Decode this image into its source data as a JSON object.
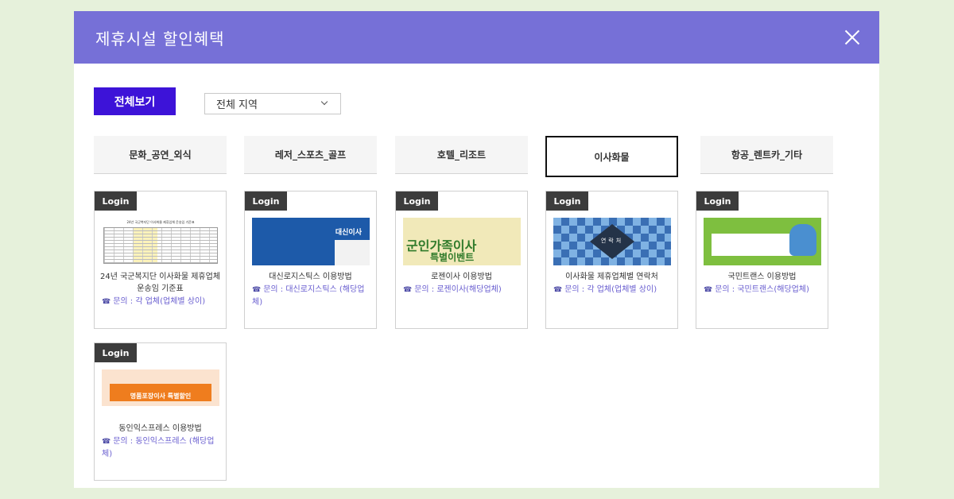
{
  "modal": {
    "title": "제휴시설 할인혜택"
  },
  "filter": {
    "all_button": "전체보기",
    "region_select": "전체 지역"
  },
  "tabs": [
    {
      "label": "문화_공연_외식",
      "active": false
    },
    {
      "label": "레저_스포츠_골프",
      "active": false
    },
    {
      "label": "호텔_리조트",
      "active": false
    },
    {
      "label": "이사화물",
      "active": true
    },
    {
      "label": "항공_렌트카_기타",
      "active": false
    }
  ],
  "cards": [
    {
      "badge": "Login",
      "title": "24년 국군복지단 이사화물 제휴업체 운송임 기준표",
      "contact": "문의 : 각 업체(업체별 상이)",
      "thumb_type": "sheet",
      "thumb_text": "24년 국군복지단 이사화물 제휴업체 운송임 기준표"
    },
    {
      "badge": "Login",
      "title": "대신로지스틱스 이용방법",
      "contact": "문의 : 대신로지스틱스 (해당업체)",
      "thumb_type": "blue",
      "thumb_text": "대신이사"
    },
    {
      "badge": "Login",
      "title": "로젠이사 이용방법",
      "contact": "문의 : 로젠이사(해당업체)",
      "thumb_type": "yellow",
      "thumb_text": "군인가족이사",
      "thumb_text2": "특별이벤트"
    },
    {
      "badge": "Login",
      "title": "이사화물 제휴업체별 연락처",
      "contact": "문의 : 각 업체(업체별 상이)",
      "thumb_type": "diamond",
      "thumb_text": "연락처"
    },
    {
      "badge": "Login",
      "title": "국민트랜스 이용방법",
      "contact": "문의 : 국민트랜스(해당업체)",
      "thumb_type": "green",
      "thumb_text": ""
    },
    {
      "badge": "Login",
      "title": "동인익스프레스 이용방법",
      "contact": "문의 : 동인익스프레스 (해당업체)",
      "thumb_type": "orange",
      "thumb_text": "명품포장이사 특별할인"
    }
  ],
  "icons": {
    "close": "close-icon",
    "phone": "phone-icon",
    "dropdown": "chevron-down-icon"
  },
  "colors": {
    "header": "#7670d7",
    "all_button": "#3d13d8",
    "contact_text": "#6a5fd0",
    "background": "#e6f1db"
  }
}
